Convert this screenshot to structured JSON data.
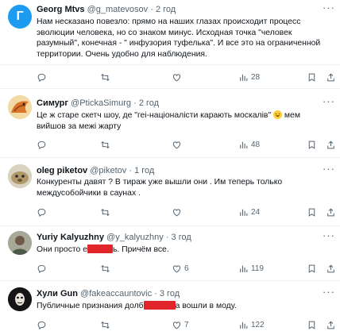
{
  "tweets": [
    {
      "name": "Georg Mtvs",
      "handle": "@g_matevosov",
      "time": "2 год",
      "avatar_letter": "Г",
      "text": "Нам несказано повезло: прямо на наших глазах происходит процесс эволюции человека, но со знаком минус. Исходная точка \"человек разумный\", конечная - \" инфузория туфелька\". И все это на ограниченной территории. Очень удобно для наблюдения.",
      "likes": "",
      "views": "28"
    },
    {
      "name": "Симург",
      "handle": "@PtickaSimurg",
      "time": "2 год",
      "text_before": "Це ж старе скетч шоу, де \"геі-націоналісти карають москалів\" ",
      "text_after": " мем вийшов за межі жарту",
      "likes": "",
      "views": "48"
    },
    {
      "name": "oleg piketov",
      "handle": "@piketov",
      "time": "1 год",
      "text": "Конкуренты давят ? В тираж уже вышли они . Им теперь только междусобойчики в саунах .",
      "likes": "",
      "views": "24"
    },
    {
      "name": "Yuriy Kalyuzhny",
      "handle": "@y_kalyuzhny",
      "time": "3 год",
      "text_before": "Они просто е",
      "text_after": "ь. Причём все.",
      "likes": "6",
      "views": "119"
    },
    {
      "name": "Хули Gun",
      "handle": "@fakeaccauntovic",
      "time": "3 год",
      "text_before": "Публичные признания долб",
      "text_after": "а вошли в моду.",
      "likes": "7",
      "views": "122"
    }
  ],
  "ui": {
    "dot": "·",
    "more": "···"
  },
  "colors": {
    "text": "#0f1419",
    "secondary": "#536471",
    "divider": "#eff3f4",
    "redaction": "#e0262a",
    "avatar1": "#1d9bf0"
  }
}
